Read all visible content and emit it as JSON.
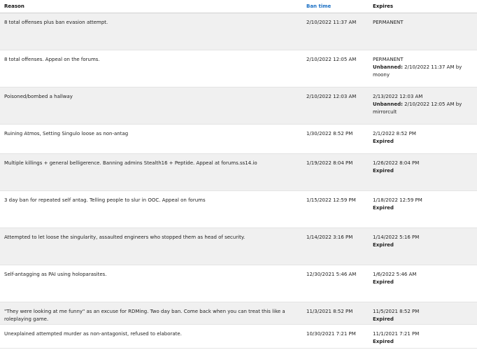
{
  "columns": {
    "reason": "Reason",
    "ban_time": "Ban time",
    "expires": "Expires"
  },
  "colors": {
    "header_link": "#1a6fc4",
    "row_shade": "#f0f0f0"
  },
  "rows": [
    {
      "reason": "8 total offenses plus ban evasion attempt.",
      "ban_time": "2/10/2022 11:37 AM",
      "expires": "PERMANENT",
      "status": "",
      "status_detail": ""
    },
    {
      "reason": "8 total offenses. Appeal on the forums.",
      "ban_time": "2/10/2022 12:05 AM",
      "expires": "PERMANENT",
      "status": "Unbanned:",
      "status_detail": "2/10/2022 11:37 AM by moony"
    },
    {
      "reason": "Poisoned/bombed a hallway",
      "ban_time": "2/10/2022 12:03 AM",
      "expires": "2/13/2022 12:03 AM",
      "status": "Unbanned:",
      "status_detail": "2/10/2022 12:05 AM by mirrorcult"
    },
    {
      "reason": "Ruining Atmos, Setting Singulo loose as non-antag",
      "ban_time": "1/30/2022 8:52 PM",
      "expires": "2/1/2022 8:52 PM",
      "status": "Expired",
      "status_detail": ""
    },
    {
      "reason": "Multiple killings + general belligerence. Banning admins Stealth16 + Peptide. Appeal at forums.ss14.io",
      "ban_time": "1/19/2022 8:04 PM",
      "expires": "1/26/2022 8:04 PM",
      "status": "Expired",
      "status_detail": ""
    },
    {
      "reason": "3 day ban for repeated self antag. Telling people to slur in OOC. Appeal on forums",
      "ban_time": "1/15/2022 12:59 PM",
      "expires": "1/18/2022 12:59 PM",
      "status": "Expired",
      "status_detail": ""
    },
    {
      "reason": "Attempted to let loose the singularity, assaulted engineers who stopped them as head of security.",
      "ban_time": "1/14/2022 3:16 PM",
      "expires": "1/14/2022 5:16 PM",
      "status": "Expired",
      "status_detail": ""
    },
    {
      "reason": "Self-antagging as PAI using holoparasites.",
      "ban_time": "12/30/2021 5:46 AM",
      "expires": "1/6/2022 5:46 AM",
      "status": "Expired",
      "status_detail": ""
    },
    {
      "reason": "\"They were looking at me funny\" as an excuse for RDMing. Two day ban. Come back when you can treat this like a roleplaying game.",
      "ban_time": "11/3/2021 8:52 PM",
      "expires": "11/5/2021 8:52 PM",
      "status": "Expired",
      "status_detail": ""
    },
    {
      "reason": "Unexplained attempted murder as non-antagonist, refused to elaborate.",
      "ban_time": "10/30/2021 7:21 PM",
      "expires": "11/1/2021 7:21 PM",
      "status": "Expired",
      "status_detail": ""
    }
  ]
}
